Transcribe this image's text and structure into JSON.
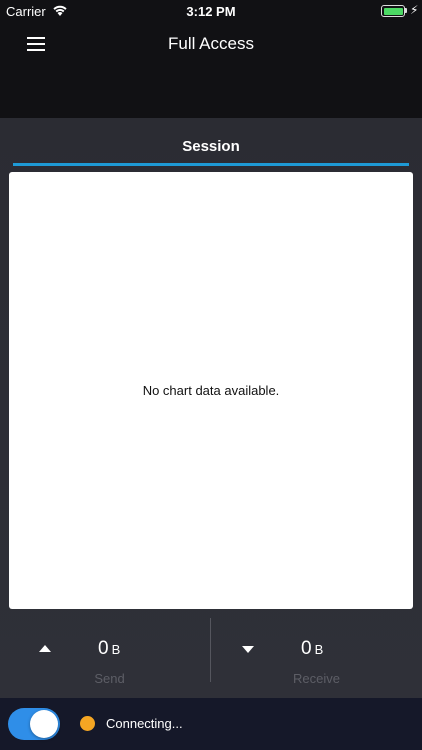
{
  "status_bar": {
    "carrier": "Carrier",
    "time": "3:12 PM",
    "battery_level": 1.0
  },
  "nav": {
    "title": "Full Access"
  },
  "tabs": {
    "session": "Session"
  },
  "chart": {
    "empty_message": "No chart data available."
  },
  "stats": {
    "send": {
      "value": "0",
      "unit": "B",
      "label": "Send"
    },
    "receive": {
      "value": "0",
      "unit": "B",
      "label": "Receive"
    }
  },
  "connection": {
    "status_text": "Connecting...",
    "status_color": "#f5a623",
    "toggle_on": true,
    "toggle_color": "#2f8ee8"
  },
  "colors": {
    "accent": "#1e9ad6",
    "background": "#2b2c33",
    "bottom_bar": "#151829"
  }
}
